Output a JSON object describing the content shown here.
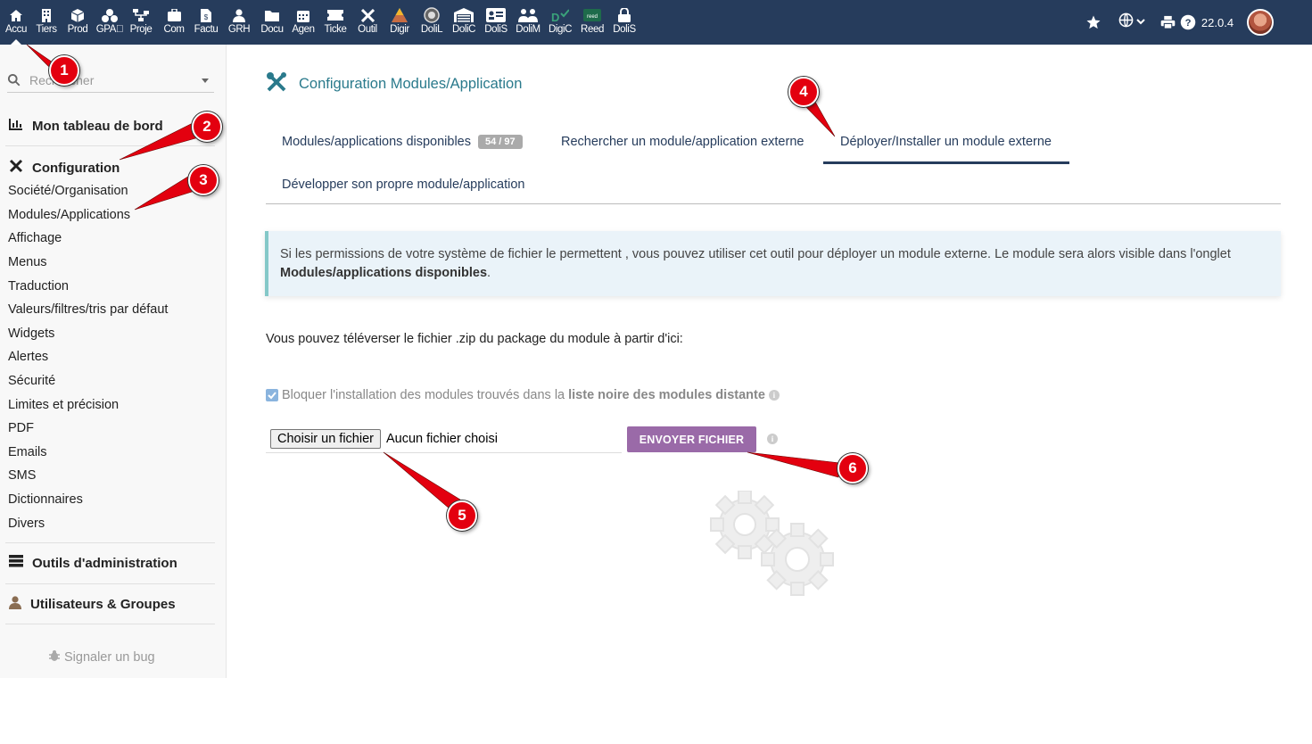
{
  "topbar": {
    "menu": [
      {
        "label": "Accu",
        "icon": "home-icon"
      },
      {
        "label": "Tiers",
        "icon": "building-icon"
      },
      {
        "label": "Prod",
        "icon": "cube-icon"
      },
      {
        "label": "GPA\u0000",
        "icon": "cubes-icon"
      },
      {
        "label": "Proje",
        "icon": "sitemap-icon"
      },
      {
        "label": "Com",
        "icon": "suitcase-icon"
      },
      {
        "label": "Factu",
        "icon": "invoice-icon"
      },
      {
        "label": "GRH",
        "icon": "user-icon"
      },
      {
        "label": "Docu",
        "icon": "folder-icon"
      },
      {
        "label": "Agen",
        "icon": "calendar-icon"
      },
      {
        "label": "Ticke",
        "icon": "ticket-icon"
      },
      {
        "label": "Outil",
        "icon": "tools-icon"
      },
      {
        "label": "Digir",
        "icon": "triangle-logo-icon"
      },
      {
        "label": "DoliL",
        "icon": "doli-logo-icon"
      },
      {
        "label": "DoliC",
        "icon": "garage-icon"
      },
      {
        "label": "DoliS",
        "icon": "id-card-icon"
      },
      {
        "label": "DoliM",
        "icon": "users-icon"
      },
      {
        "label": "DigiC",
        "icon": "digic-logo-icon"
      },
      {
        "label": "Reed",
        "icon": "reed-logo-icon"
      },
      {
        "label": "DoliS",
        "icon": "lock-icon"
      }
    ],
    "version": "22.0.4"
  },
  "sidebar": {
    "search_placeholder": "Rechercher",
    "dashboard": "Mon tableau de bord",
    "configuration": "Configuration",
    "items": [
      "Société/Organisation",
      "Modules/Applications",
      "Affichage",
      "Menus",
      "Traduction",
      "Valeurs/filtres/tris par défaut",
      "Widgets",
      "Alertes",
      "Sécurité",
      "Limites et précision",
      "PDF",
      "Emails",
      "SMS",
      "Dictionnaires",
      "Divers"
    ],
    "admin_tools": "Outils d'administration",
    "users_groups": "Utilisateurs & Groupes",
    "report_bug": "Signaler un bug"
  },
  "main": {
    "title": "Configuration Modules/Application",
    "tabs": {
      "available": "Modules/applications disponibles",
      "available_badge": "54 / 97",
      "search_external": "Rechercher un module/application externe",
      "deploy": "Déployer/Installer un module externe",
      "develop": "Développer son propre module/application"
    },
    "info_text": "Si les permissions de votre système de fichier le permettent , vous pouvez utiliser cet outil pour déployer un module externe. Le module sera alors visible dans l'onglet",
    "info_bold": "Modules/applications disponibles",
    "info_end": ".",
    "upload_text": "Vous pouvez téléverser le fichier .zip du package du module à partir d'ici:",
    "block_text": "Bloquer l'installation des modules trouvés dans la",
    "block_bold": "liste noire des modules distante",
    "choose_file": "Choisir un fichier",
    "no_file": "Aucun fichier choisi",
    "send_button": "ENVOYER FICHIER"
  },
  "annotations": [
    "1",
    "2",
    "3",
    "4",
    "5",
    "6"
  ],
  "colors": {
    "topbar": "#263c5c",
    "accent": "#263c5c",
    "title": "#2a7a8c",
    "send_button": "#9a6aa8",
    "marker": "#e3000f"
  }
}
